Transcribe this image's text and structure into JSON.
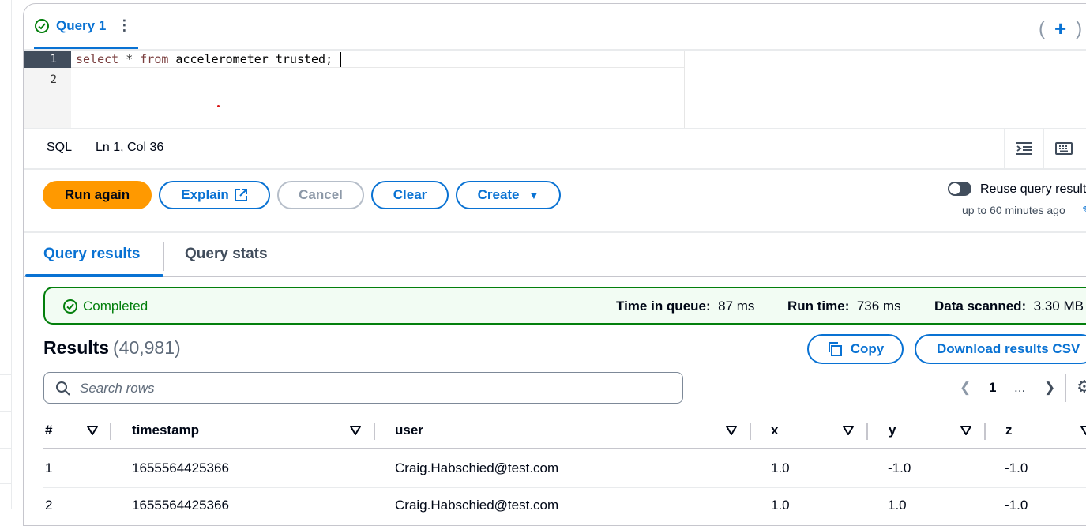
{
  "editor_tab": {
    "title": "Query 1",
    "status_icon": "check-circle-icon",
    "more_icon": "more-vertical-icon"
  },
  "tab_actions": {
    "add_icon": "plus-icon",
    "overflow_icon": "caret-down-icon"
  },
  "editor": {
    "line_numbers": [
      "1",
      "2"
    ],
    "code": {
      "kw1": "select",
      "op": " * ",
      "kw2": "from",
      "rest": " accelerometer_trusted;"
    }
  },
  "statusbar": {
    "language": "SQL",
    "cursor_position": "Ln 1, Col 36"
  },
  "buttons": {
    "run": "Run again",
    "explain": "Explain",
    "cancel": "Cancel",
    "clear": "Clear",
    "create": "Create"
  },
  "reuse": {
    "label": "Reuse query results",
    "sub": "up to 60 minutes ago",
    "enabled": false
  },
  "result_tabs": {
    "results": "Query results",
    "stats": "Query stats"
  },
  "banner": {
    "status": "Completed",
    "queue_label": "Time in queue:",
    "queue_value": "87 ms",
    "run_label": "Run time:",
    "run_value": "736 ms",
    "scanned_label": "Data scanned:",
    "scanned_value": "3.30 MB"
  },
  "results": {
    "title": "Results",
    "count": "(40,981)",
    "copy": "Copy",
    "download": "Download results CSV",
    "search_placeholder": "Search rows",
    "pager": {
      "page": "1",
      "ellipsis": "..."
    }
  },
  "table": {
    "columns": [
      "#",
      "timestamp",
      "user",
      "x",
      "y",
      "z"
    ],
    "rows": [
      [
        "1",
        "1655564425366",
        "Craig.Habschied@test.com",
        "1.0",
        "-1.0",
        "-1.0"
      ],
      [
        "2",
        "1655564425366",
        "Craig.Habschied@test.com",
        "1.0",
        "1.0",
        "-1.0"
      ]
    ]
  },
  "colors": {
    "accent": "#0972d3",
    "primary": "#ff9900",
    "success": "#037f0c"
  }
}
